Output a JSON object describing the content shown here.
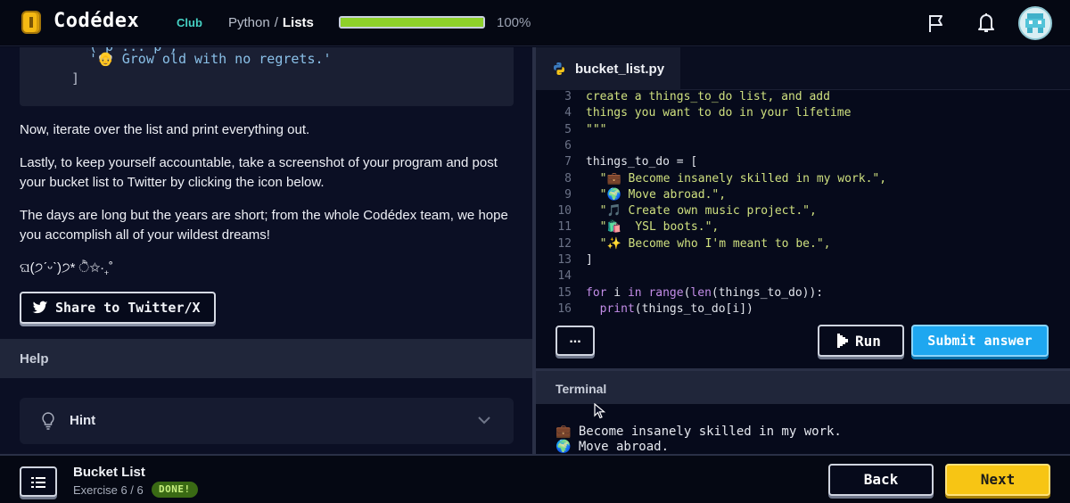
{
  "header": {
    "logo_text": "Codédex",
    "logo_badge": "Club",
    "breadcrumb_course": "Python",
    "breadcrumb_separator": "/",
    "breadcrumb_current": "Lists",
    "progress_value": 1.0,
    "progress_label": "100%",
    "accent_progress": "#8ed12a"
  },
  "left": {
    "snippet_line0": "( p  ...  p  ,",
    "snippet_line1": "'👴 Grow old with no regrets.'",
    "snippet_line2": "]",
    "para1": "Now, iterate over the list and print everything out.",
    "para2": "Lastly, to keep yourself accountable, take a screenshot of your program and post your bucket list to Twitter by clicking the icon below.",
    "para3": "The days are long but the years are short; from the whole Codédex team, we hope you accomplish all of your wildest dreams!",
    "kaomoji": "ଘ(੭ˊᵕˋ)੭* ੈ✩‧₊˚",
    "share_label": "Share to Twitter/X",
    "help_label": "Help",
    "hint_label": "Hint"
  },
  "editor": {
    "tab_label": "bucket_list.py",
    "lines": [
      {
        "num": "3",
        "text": "create a things_to_do list, and add"
      },
      {
        "num": "4",
        "text": "things you want to do in your lifetime"
      },
      {
        "num": "5",
        "text": "\"\"\""
      },
      {
        "num": "6",
        "text": ""
      },
      {
        "num": "7",
        "text": "things_to_do = ["
      },
      {
        "num": "8",
        "text": "  \"💼 Become insanely skilled in my work.\","
      },
      {
        "num": "9",
        "text": "  \"🌍 Move abroad.\","
      },
      {
        "num": "10",
        "text": "  \"🎵 Create own music project.\","
      },
      {
        "num": "11",
        "text": "  \"🛍️  YSL boots.\","
      },
      {
        "num": "12",
        "text": "  \"✨ Become who I'm meant to be.\","
      },
      {
        "num": "13",
        "text": "]"
      },
      {
        "num": "14",
        "text": ""
      },
      {
        "num": "15",
        "text": "for i in range(len(things_to_do)):"
      },
      {
        "num": "16",
        "text": "  print(things_to_do[i])"
      }
    ],
    "more_label": "...",
    "run_label": "Run",
    "submit_label": "Submit answer"
  },
  "terminal": {
    "label": "Terminal",
    "output": [
      "💼 Become insanely skilled in my work.",
      "🌍 Move abroad."
    ]
  },
  "footer": {
    "exercise_title": "Bucket List",
    "exercise_progress": "Exercise 6 / 6",
    "status_badge": "DONE!",
    "back_label": "Back",
    "next_label": "Next"
  }
}
